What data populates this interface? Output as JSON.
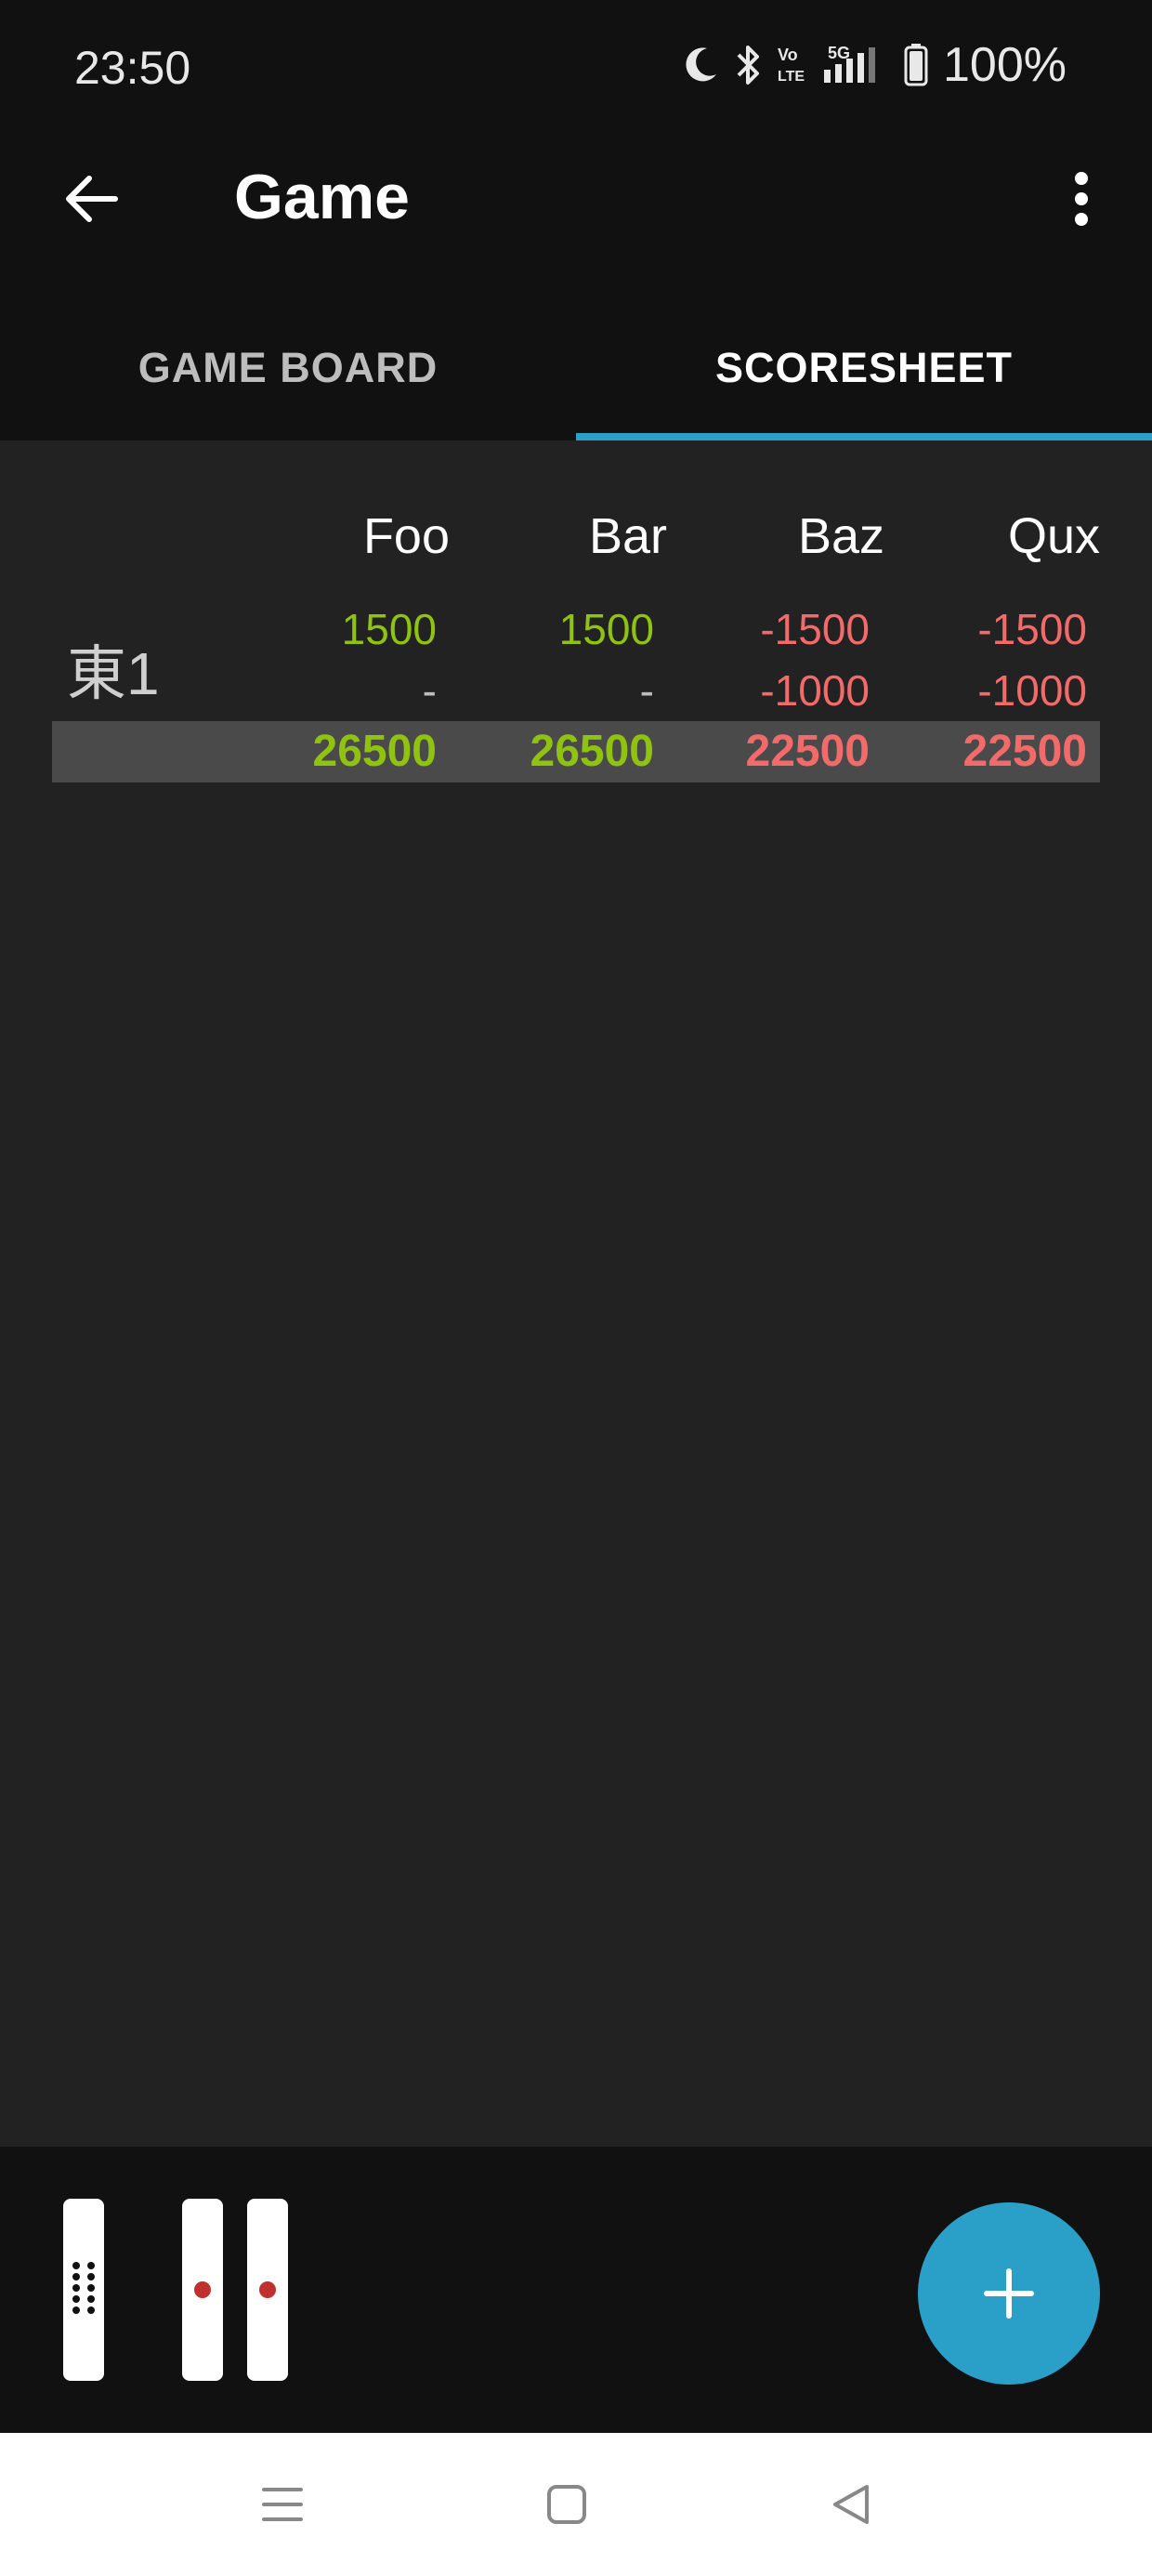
{
  "status_bar": {
    "time": "23:50",
    "battery": "100%",
    "icons": [
      "moon-icon",
      "bluetooth-icon",
      "volte-icon",
      "5g-signal-icon",
      "battery-icon"
    ]
  },
  "app_bar": {
    "title": "Game",
    "back_icon": "arrow-left-icon",
    "menu_icon": "more-vert-icon"
  },
  "tabs": [
    {
      "label": "GAME BOARD",
      "active": false
    },
    {
      "label": "SCORESHEET",
      "active": true
    }
  ],
  "scoresheet": {
    "players": [
      "Foo",
      "Bar",
      "Baz",
      "Qux"
    ],
    "rounds": [
      {
        "label": "東1",
        "score_changes": [
          "1500",
          "1500",
          "-1500",
          "-1500"
        ],
        "riichi": [
          "-",
          "-",
          "-1000",
          "-1000"
        ],
        "totals": [
          "26500",
          "26500",
          "22500",
          "22500"
        ]
      }
    ]
  },
  "bottom_bar": {
    "sticks": [
      "thousand-point-stick-icon",
      "hundred-point-stick-icon",
      "hundred-point-stick-icon"
    ],
    "fab_icon": "plus-icon"
  },
  "nav_bar": {
    "icons": [
      "recents-icon",
      "home-icon",
      "back-triangle-icon"
    ]
  },
  "colors": {
    "accent": "#2aa0c8",
    "positive": "#8fc30f",
    "negative": "#f26a6a",
    "stick_dot": "#c0302c"
  }
}
